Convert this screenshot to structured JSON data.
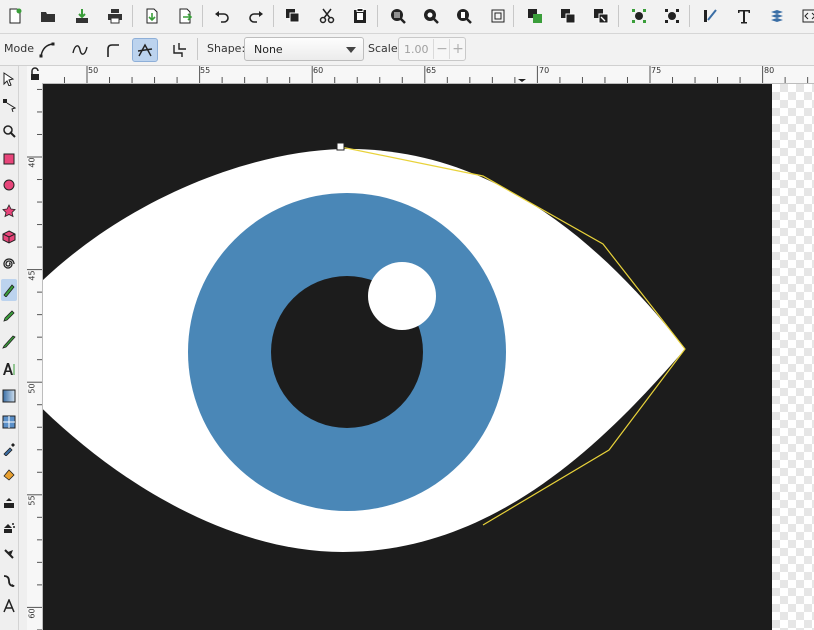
{
  "commands_bar": {
    "buttons": [
      {
        "name": "new-document-icon",
        "label": "New"
      },
      {
        "name": "open-icon",
        "label": "Open"
      },
      {
        "name": "save-icon",
        "label": "Save"
      },
      {
        "name": "print-icon",
        "label": "Print"
      },
      {
        "name": "import-icon",
        "label": "Import"
      },
      {
        "name": "export-icon",
        "label": "Export"
      },
      {
        "name": "undo-icon",
        "label": "Undo"
      },
      {
        "name": "redo-icon",
        "label": "Redo"
      },
      {
        "name": "copy-icon",
        "label": "Copy"
      },
      {
        "name": "cut-icon",
        "label": "Cut"
      },
      {
        "name": "paste-icon",
        "label": "Paste"
      },
      {
        "name": "zoom-selection-icon",
        "label": "Zoom selection"
      },
      {
        "name": "zoom-drawing-icon",
        "label": "Zoom drawing"
      },
      {
        "name": "zoom-page-icon",
        "label": "Zoom page"
      },
      {
        "name": "zoom-fit-icon",
        "label": "Zoom fit"
      },
      {
        "name": "duplicate-icon",
        "label": "Duplicate"
      },
      {
        "name": "clone-icon",
        "label": "Clone"
      },
      {
        "name": "unlink-clone-icon",
        "label": "Unlink clone"
      },
      {
        "name": "group-icon",
        "label": "Group"
      },
      {
        "name": "ungroup-icon",
        "label": "Ungroup"
      },
      {
        "name": "fill-stroke-icon",
        "label": "Fill and stroke"
      },
      {
        "name": "text-font-icon",
        "label": "Text and font"
      },
      {
        "name": "layers-icon",
        "label": "Layers"
      },
      {
        "name": "xml-editor-icon",
        "label": "XML editor"
      }
    ]
  },
  "tool_controls": {
    "mode_label": "Mode",
    "modes": [
      "bezier-mode-icon",
      "spiro-mode-icon",
      "bspline-mode-icon",
      "straight-segments-mode-icon",
      "paraxial-mode-icon"
    ],
    "active_mode_index": 3,
    "shape_label": "Shape:",
    "shape_value": "None",
    "scale_label": "Scale:",
    "scale_value": "1.00",
    "scale_minus": "−",
    "scale_plus": "+"
  },
  "toolbox": {
    "tools": [
      "selector-tool-icon",
      "node-tool-icon",
      "tweak-tool-icon",
      "rectangle-tool-icon",
      "ellipse-tool-icon",
      "star-tool-icon",
      "box3d-tool-icon",
      "spiral-tool-icon",
      "pen-tool-icon",
      "pencil-tool-icon",
      "calligraphy-tool-icon",
      "text-tool-icon",
      "gradient-tool-icon",
      "mesh-tool-icon",
      "dropper-tool-icon",
      "paint-bucket-tool-icon",
      "spray-tool-icon",
      "eraser-tool-icon",
      "connector-tool-icon",
      "lpe-tool-icon",
      "measure-tool-icon"
    ],
    "active_tool_index": 8
  },
  "rulers": {
    "horizontal": [
      "50",
      "55",
      "60",
      "65",
      "70",
      "75",
      "80"
    ],
    "vertical": [
      "40",
      "45",
      "50",
      "55",
      "60"
    ]
  },
  "colors": {
    "canvas_bg": "#1c1c1c",
    "sclera": "#ffffff",
    "iris": "#4a87b7",
    "pupil": "#1c1c1c",
    "highlight": "#ffffff",
    "path_stroke": "#e8d23a",
    "active_tool_bg": "#bcd3ee"
  }
}
